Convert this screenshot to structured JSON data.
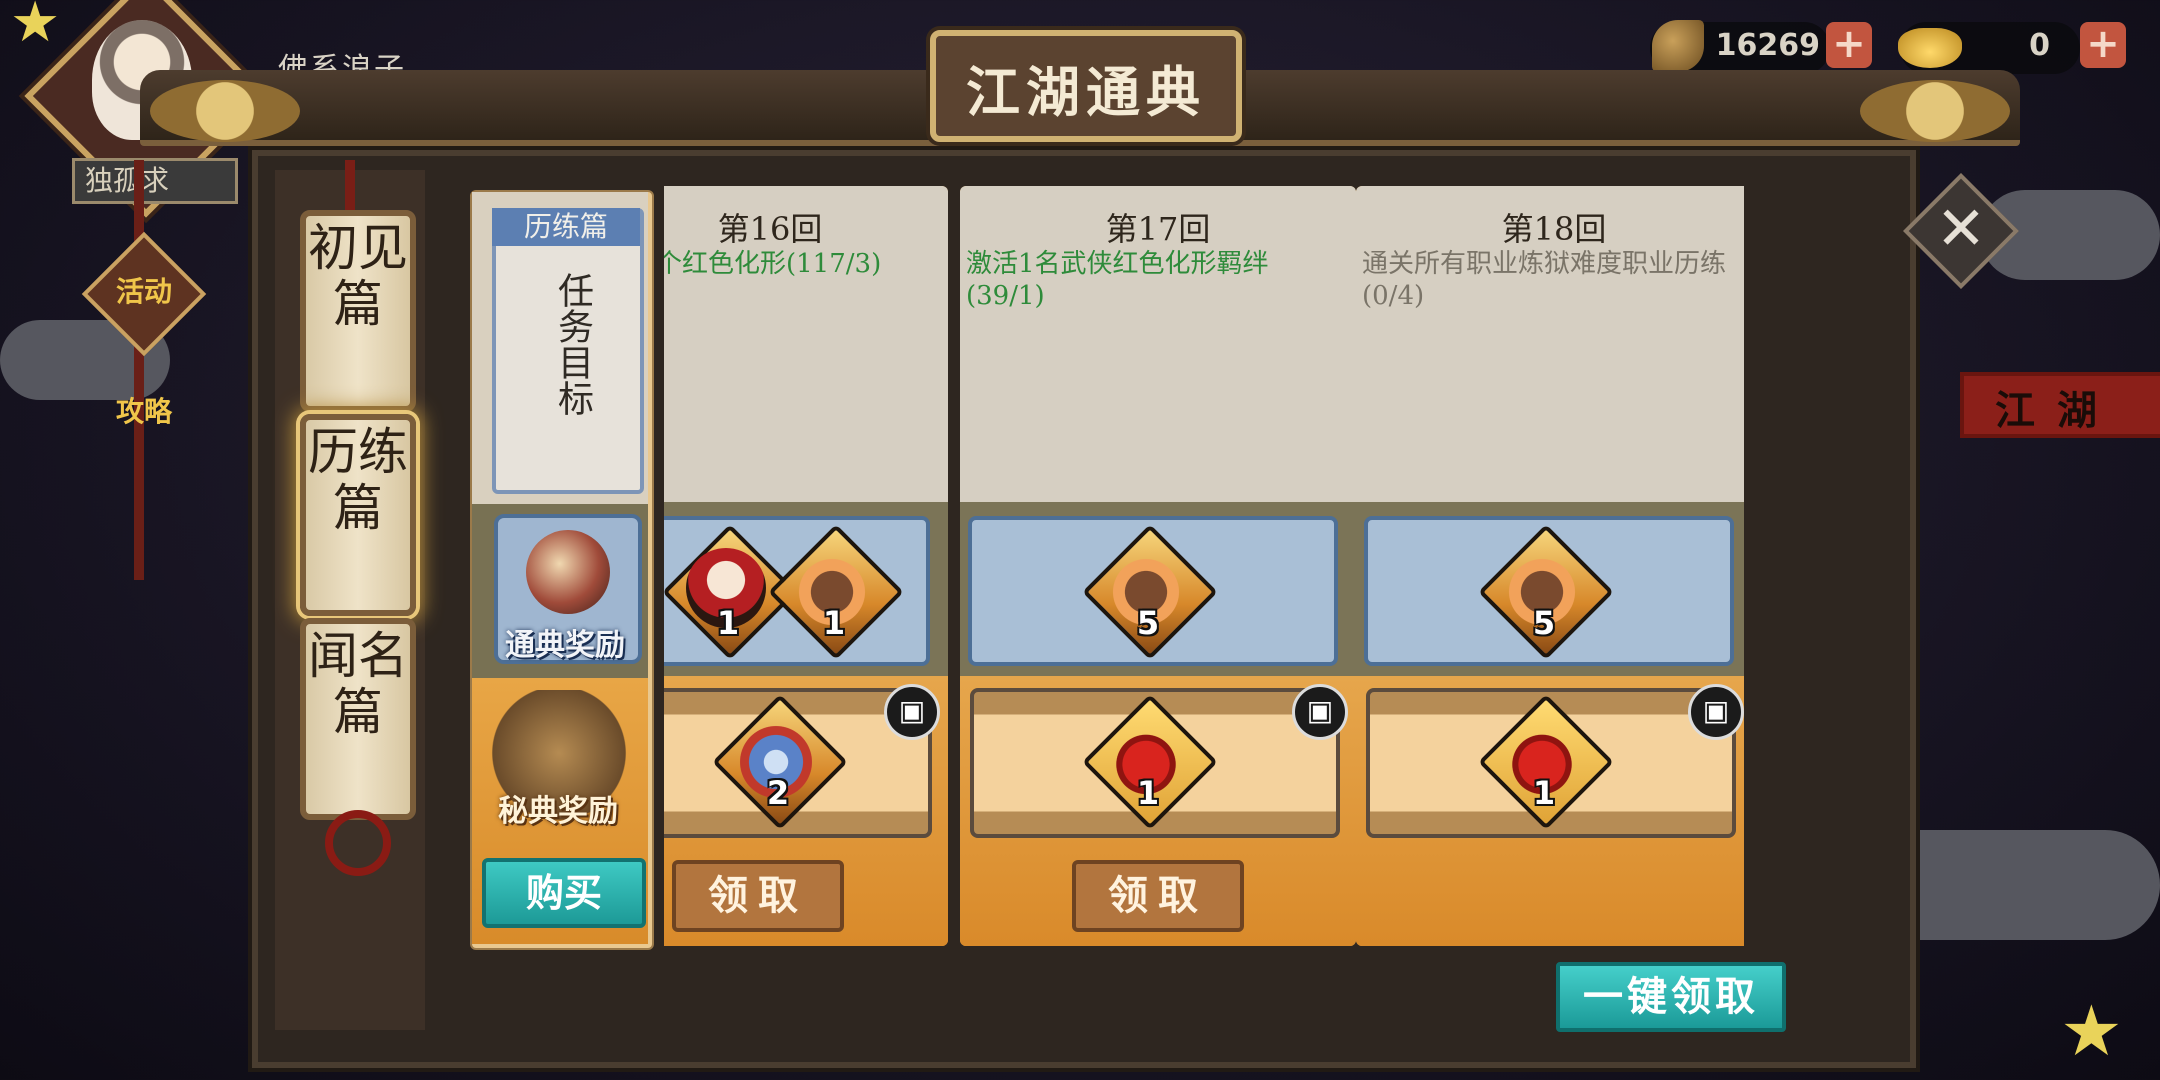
{
  "hud": {
    "player_name": "佛系浪子",
    "avatar_name": "独孤求",
    "currency_leaf": "16269",
    "currency_gold": "0",
    "plus": "+"
  },
  "side": {
    "event_1": "活动",
    "event_2": "攻略",
    "jianghu": "江湖"
  },
  "title": "江湖通典",
  "close": "✕",
  "tabs": [
    {
      "label": "初见篇",
      "active": false
    },
    {
      "label": "历练篇",
      "active": true
    },
    {
      "label": "闻名篇",
      "active": false
    }
  ],
  "left_column": {
    "section_header": "历练篇",
    "goal_label": "任务目标",
    "reward_label_1": "通典奖励",
    "reward_label_2": "秘典奖励",
    "buy_label": "购买"
  },
  "chapters": [
    {
      "title": "第16回",
      "task": "个红色化形(117/3)",
      "task_color": "#2e8b3a",
      "mid_items": [
        {
          "qty": "1",
          "kind": "hero"
        },
        {
          "qty": "1",
          "kind": "soul"
        }
      ],
      "bot_items": [
        {
          "qty": "2",
          "kind": "blue-bag"
        }
      ],
      "claim_label": "领取"
    },
    {
      "title": "第17回",
      "task": "激活1名武侠红色化形羁绊(39/1)",
      "task_color": "#2e8b3a",
      "mid_items": [
        {
          "qty": "5",
          "kind": "soul"
        }
      ],
      "bot_items": [
        {
          "qty": "1",
          "kind": "red-bag"
        }
      ],
      "claim_label": "领取"
    },
    {
      "title": "第18回",
      "task": "通关所有职业炼狱难度职业历练(0/4)",
      "task_color": "#7a7468",
      "mid_items": [
        {
          "qty": "5",
          "kind": "soul"
        }
      ],
      "bot_items": [
        {
          "qty": "1",
          "kind": "red-bag"
        }
      ],
      "claim_label": ""
    }
  ],
  "lock_icon": "lock-icon",
  "claim_all": "一键领取",
  "colors": {
    "accent_teal": "#2bb3ae",
    "task_done_green": "#2e8b3a",
    "frame_brown": "#4a3d30"
  }
}
